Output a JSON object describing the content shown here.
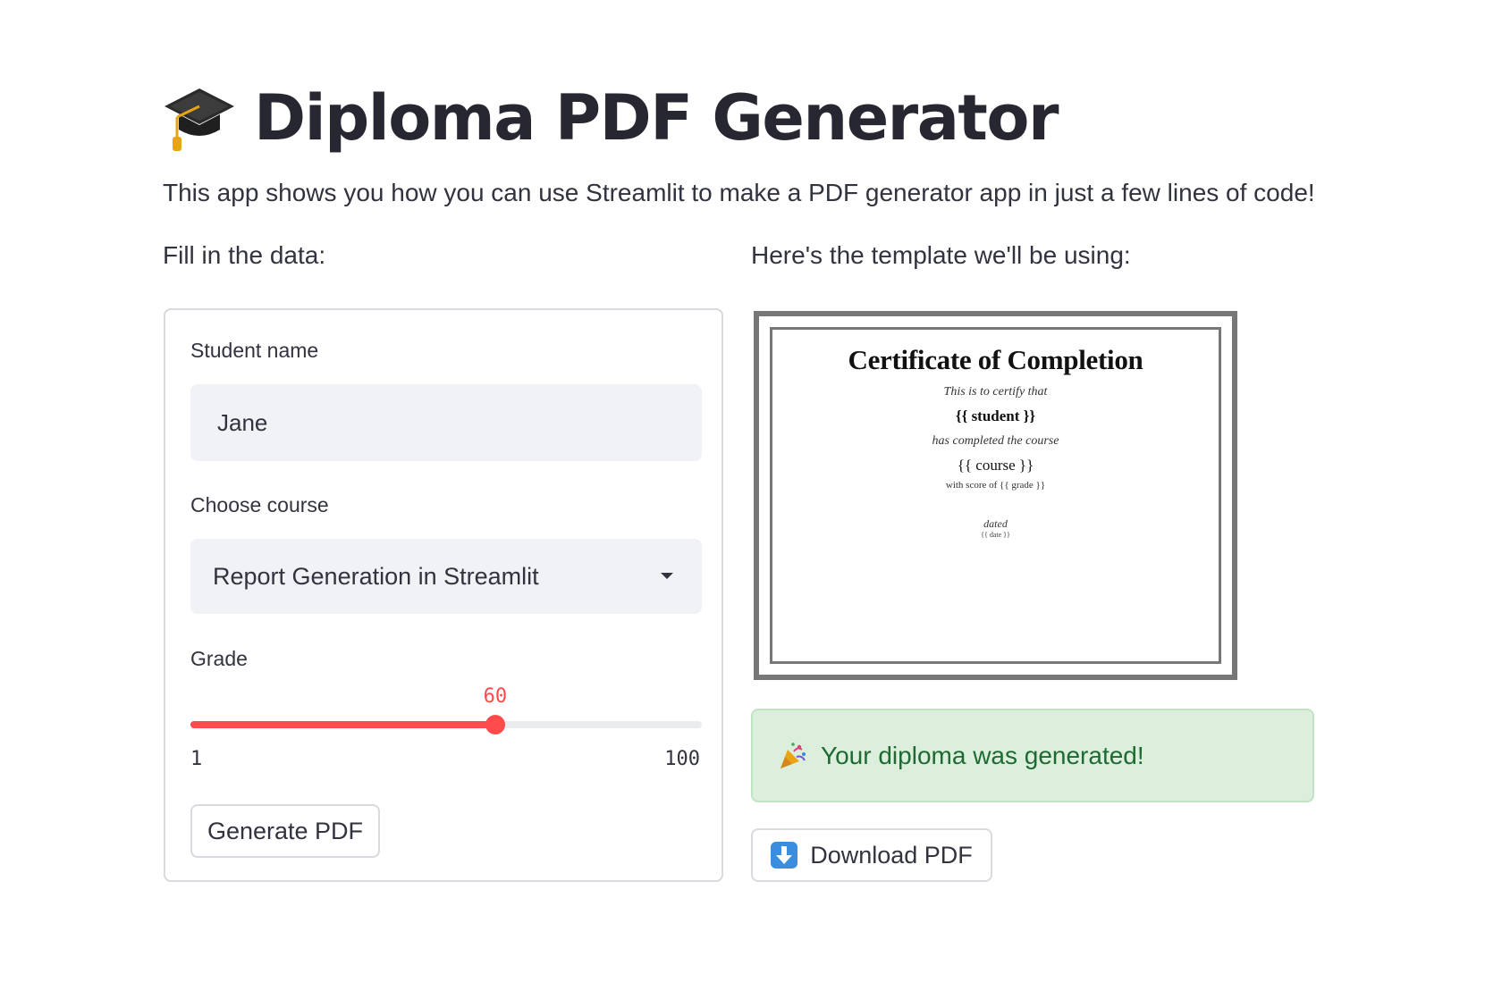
{
  "header": {
    "title": "Diploma PDF Generator",
    "icon": "graduation-cap-icon",
    "intro": "This app shows you how you can use Streamlit to make a PDF generator app in just a few lines of code!"
  },
  "left_column": {
    "label": "Fill in the data:",
    "form": {
      "student_name": {
        "label": "Student name",
        "value": "Jane"
      },
      "course": {
        "label": "Choose course",
        "selected": "Report Generation in Streamlit"
      },
      "grade": {
        "label": "Grade",
        "value": 60,
        "min": 1,
        "max": 100,
        "value_label": "60",
        "min_label": "1",
        "max_label": "100"
      },
      "submit_label": "Generate PDF"
    }
  },
  "right_column": {
    "label": "Here's the template we'll be using:",
    "template": {
      "title": "Certificate of Completion",
      "line1": "This is to certify that",
      "student": "{{ student }}",
      "line2": "has completed the course",
      "course": "{{ course }}",
      "line3": "with score of {{ grade }}",
      "dated": "dated",
      "date": "{{ date }}"
    },
    "success": {
      "icon": "party-popper-icon",
      "message": "Your diploma was generated!"
    },
    "download": {
      "icon": "down-arrow-icon",
      "label": "Download PDF"
    }
  },
  "colors": {
    "accent": "#ff4b4b",
    "text": "#31333f",
    "input_bg": "#f0f2f6",
    "success_bg": "#dcefdc",
    "success_text": "#1f6a32"
  }
}
